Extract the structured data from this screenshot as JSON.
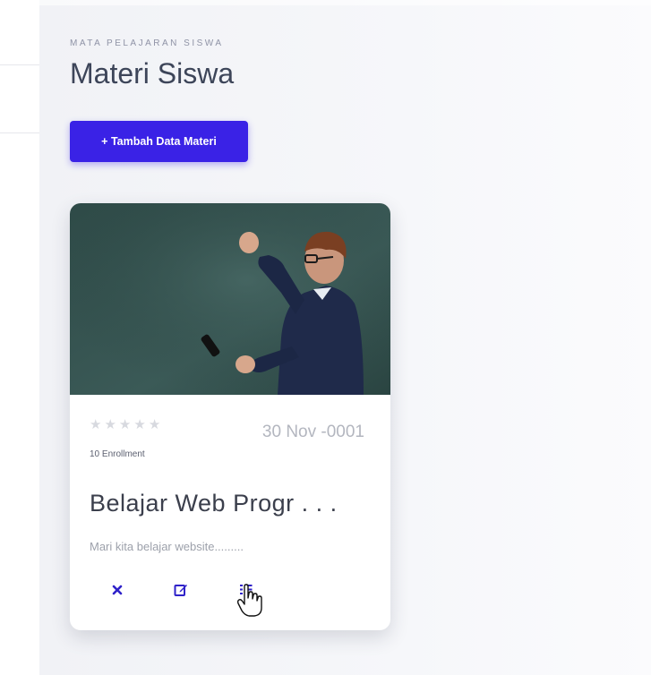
{
  "header": {
    "eyebrow": "MATA PELAJARAN SISWA",
    "title": "Materi Siswa"
  },
  "toolbar": {
    "add_label": "+ Tambah Data Materi"
  },
  "card": {
    "image_icon": "teacher-at-chalkboard-photo",
    "rating": {
      "value": 0,
      "max": 5
    },
    "date": "30 Nov -0001",
    "enrollment": "10 Enrollment",
    "title": "Belajar Web Progr . . .",
    "description": "Mari kita belajar website.........",
    "actions": [
      {
        "icon": "close-icon",
        "color": "#2f22c9"
      },
      {
        "icon": "edit-icon",
        "color": "#2f22c9"
      },
      {
        "icon": "list-icon",
        "color": "#2f22c9"
      }
    ]
  },
  "colors": {
    "accent": "#3a22e6",
    "star_empty": "#d7d9df"
  }
}
